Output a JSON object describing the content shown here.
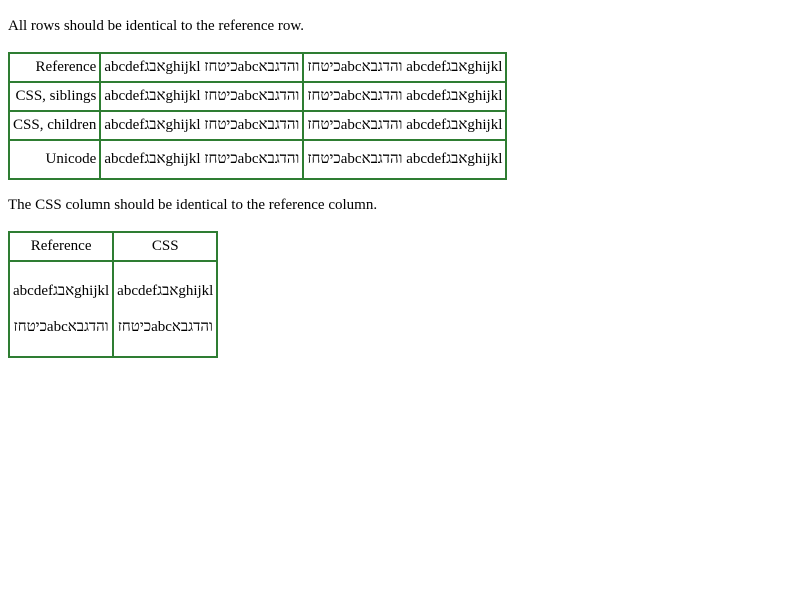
{
  "intro": "All rows should be identical to the reference row.",
  "rows": [
    {
      "label": "Reference",
      "col1": "abcdefאבגghijkl כיטחזabcוהדגבא",
      "col2": "כיטחזabcוהדגבא abcdefאבגghijkl"
    },
    {
      "label": "CSS, siblings",
      "col1": "abcdefאבגghijkl כיטחזabcוהדגבא",
      "col2": "כיטחזabcוהדגבא abcdefאבגghijkl"
    },
    {
      "label": "CSS, children",
      "col1": "abcdefאבגghijkl כיטחזabcוהדגבא",
      "col2": "כיטחזabcוהדגבא abcdefאבגghijkl"
    },
    {
      "label": "Unicode",
      "col1": "abcdefאבגghijkl כיטחזabcוהדגבא",
      "col2": "כיטחזabcוהדגבא abcdefאבגghijkl"
    }
  ],
  "second_intro": "The CSS column should be identical to the reference column.",
  "columns": {
    "reference_header": "Reference",
    "css_header": "CSS",
    "reference_line1": "abcdefאבגghijkl",
    "reference_line2": "כיטחזabcוהדגבא",
    "css_line1": "abcdefאבגghijkl",
    "css_line2": "כיטחזabcוהדגבא"
  }
}
